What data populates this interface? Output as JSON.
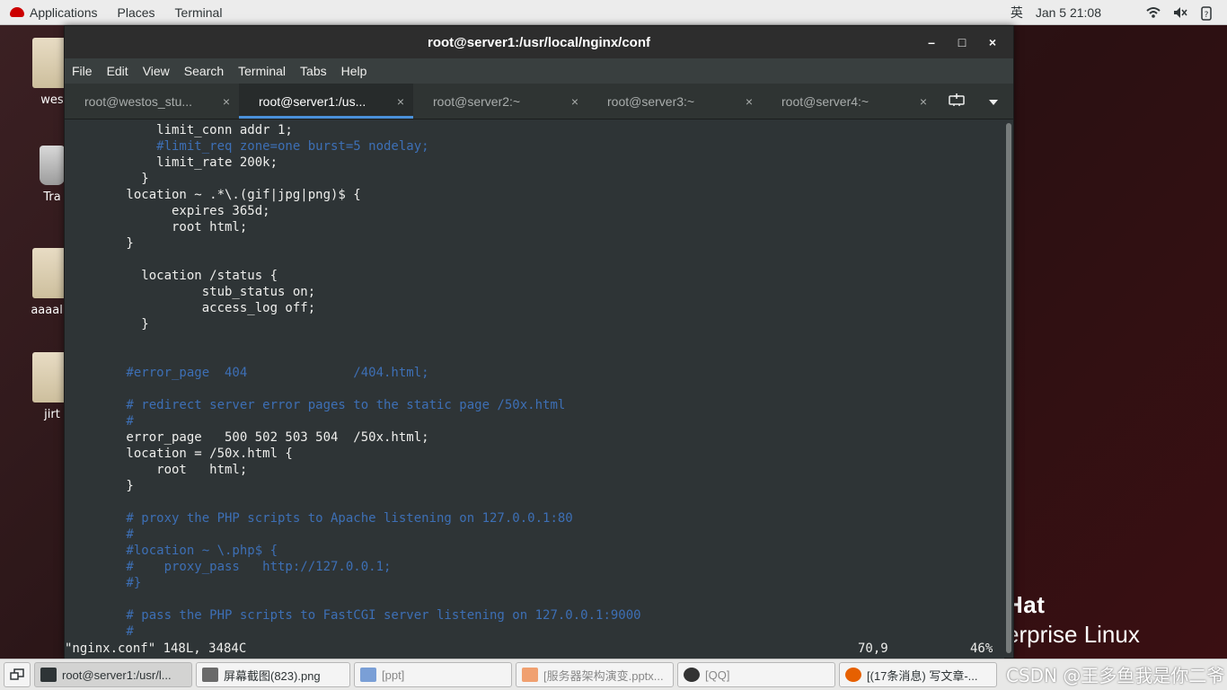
{
  "topbar": {
    "applications": "Applications",
    "places": "Places",
    "terminal": "Terminal",
    "input_method": "英",
    "datetime": "Jan 5  21:08"
  },
  "desktop": {
    "icons": [
      "wes",
      "Tra",
      "aaaalin",
      "jirt"
    ],
    "brand_line1": "Hat",
    "brand_line2": "erprise Linux"
  },
  "window": {
    "title": "root@server1:/usr/local/nginx/conf",
    "controls": {
      "minimize": "–",
      "maximize": "□",
      "close": "×"
    }
  },
  "menu": [
    "File",
    "Edit",
    "View",
    "Search",
    "Terminal",
    "Tabs",
    "Help"
  ],
  "tabs": [
    {
      "label": "root@westos_stu...",
      "close": "×"
    },
    {
      "label": "root@server1:/us...",
      "close": "×"
    },
    {
      "label": "root@server2:~",
      "close": "×"
    },
    {
      "label": "root@server3:~",
      "close": "×"
    },
    {
      "label": "root@server4:~",
      "close": "×"
    }
  ],
  "terminal": {
    "lines": [
      {
        "text": "            limit_conn addr 1;",
        "comment": false
      },
      {
        "text": "            #limit_req zone=one burst=5 nodelay;",
        "comment": true
      },
      {
        "text": "            limit_rate 200k;",
        "comment": false
      },
      {
        "text": "          }",
        "comment": false
      },
      {
        "text": "        location ~ .*\\.(gif|jpg|png)$ {",
        "comment": false
      },
      {
        "text": "              expires 365d;",
        "comment": false
      },
      {
        "text": "              root html;",
        "comment": false
      },
      {
        "text": "        }",
        "comment": false
      },
      {
        "text": "",
        "comment": false
      },
      {
        "text": "          location /status {",
        "comment": false
      },
      {
        "text": "                  stub_status on;",
        "comment": false
      },
      {
        "text": "                  access_log off;",
        "comment": false
      },
      {
        "text": "          }",
        "comment": false
      },
      {
        "text": "",
        "comment": false
      },
      {
        "text": "",
        "comment": false
      },
      {
        "text": "        #error_page  404              /404.html;",
        "comment": true
      },
      {
        "text": "",
        "comment": false
      },
      {
        "text": "        # redirect server error pages to the static page /50x.html",
        "comment": true
      },
      {
        "text": "        #",
        "comment": true
      },
      {
        "text": "        error_page   500 502 503 504  /50x.html;",
        "comment": false
      },
      {
        "text": "        location = /50x.html {",
        "comment": false
      },
      {
        "text": "            root   html;",
        "comment": false
      },
      {
        "text": "        }",
        "comment": false
      },
      {
        "text": "",
        "comment": false
      },
      {
        "text": "        # proxy the PHP scripts to Apache listening on 127.0.0.1:80",
        "comment": true
      },
      {
        "text": "        #",
        "comment": true
      },
      {
        "text": "        #location ~ \\.php$ {",
        "comment": true
      },
      {
        "text": "        #    proxy_pass   http://127.0.0.1;",
        "comment": true
      },
      {
        "text": "        #}",
        "comment": true
      },
      {
        "text": "",
        "comment": false
      },
      {
        "text": "        # pass the PHP scripts to FastCGI server listening on 127.0.0.1:9000",
        "comment": true
      },
      {
        "text": "        #",
        "comment": true
      }
    ],
    "status_file": "\"nginx.conf\" 148L, 3484C",
    "status_pos": "70,9",
    "status_pct": "46%"
  },
  "taskbar": {
    "items": [
      {
        "label": "root@server1:/usr/l...",
        "icon": "terminal-icon",
        "color": "#2e3436"
      },
      {
        "label": "屏幕截图(823).png",
        "icon": "image-viewer-icon",
        "color": "#6a6a6a"
      },
      {
        "label": "[ppt]",
        "icon": "folder-doc-icon",
        "color": "#7a9fd6"
      },
      {
        "label": "[服务器架构演变.pptx...",
        "icon": "presentation-icon",
        "color": "#f0a070"
      },
      {
        "label": "[QQ]",
        "icon": "qq-penguin-icon",
        "color": "#333333"
      },
      {
        "label": "[(17条消息) 写文章-...",
        "icon": "firefox-icon",
        "color": "#e66000"
      }
    ],
    "watermark": "CSDN @王多鱼我是你二爷"
  }
}
